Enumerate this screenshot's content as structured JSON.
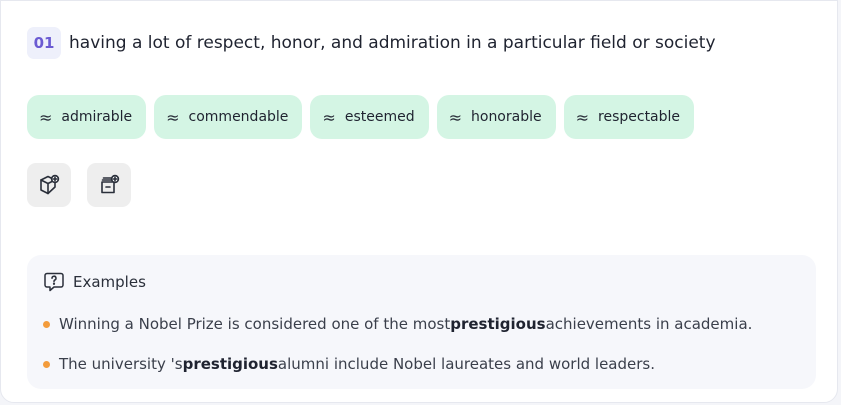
{
  "definition": {
    "number": "01",
    "text": "having a lot of respect, honor, and admiration in a particular field or society"
  },
  "synonyms": [
    {
      "symbol": "≈",
      "label": "admirable"
    },
    {
      "symbol": "≈",
      "label": "commendable"
    },
    {
      "symbol": "≈",
      "label": "esteemed"
    },
    {
      "symbol": "≈",
      "label": "honorable"
    },
    {
      "symbol": "≈",
      "label": "respectable"
    }
  ],
  "actions": [
    {
      "icon": "cube-add-icon"
    },
    {
      "icon": "archive-add-icon"
    }
  ],
  "examples": {
    "title": "Examples",
    "items": [
      {
        "before": "Winning a Nobel Prize is considered one of the most ",
        "highlight": "prestigious",
        "after": " achievements in academia."
      },
      {
        "before": "The university 's ",
        "highlight": "prestigious",
        "after": " alumni include Nobel laureates and world leaders."
      }
    ]
  },
  "colors": {
    "chip_bg": "#d4f5e4",
    "badge_text": "#6b5bd2",
    "bullet": "#f39c3c"
  }
}
